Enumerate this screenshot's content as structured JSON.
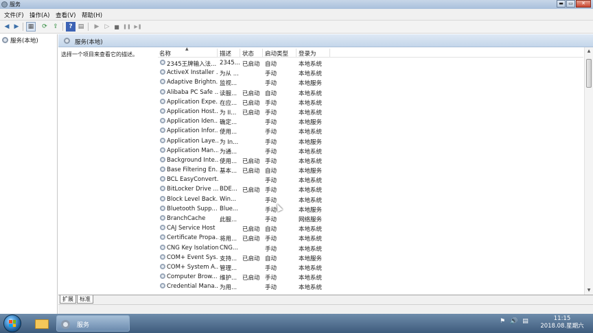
{
  "window": {
    "title": "服务",
    "buttons": {
      "minimize": "▬",
      "maximize": "▭",
      "close": "✕"
    }
  },
  "menu": [
    {
      "label": "文件(F)"
    },
    {
      "label": "操作(A)"
    },
    {
      "label": "查看(V)"
    },
    {
      "label": "帮助(H)"
    }
  ],
  "toolbar": {
    "back_icon": "◀",
    "forward_icon": "▶",
    "view_icon": "▦",
    "refresh_icon": "⟳",
    "export_icon": "⇪",
    "help_icon": "?",
    "properties_icon": "▤",
    "start_icon": "▶",
    "start2_icon": "▷",
    "stop_icon": "■",
    "pause_icon": "❚❚",
    "restart_icon": "▶❚"
  },
  "nav": {
    "root_label": "服务(本地)"
  },
  "main": {
    "header_title": "服务(本地)",
    "description_prompt": "选择一个项目来查看它的描述。",
    "columns": {
      "name": "名称",
      "description": "描述",
      "status": "状态",
      "startup": "启动类型",
      "logon": "登录为"
    },
    "sort_indicator": "▲"
  },
  "services": [
    {
      "name": "2345王牌输入法...",
      "description": "2345...",
      "status": "已启动",
      "startup": "自动",
      "logon": "本地系统"
    },
    {
      "name": "ActiveX Installer ...",
      "description": "为从 ...",
      "status": "",
      "startup": "手动",
      "logon": "本地系统"
    },
    {
      "name": "Adaptive Brightn...",
      "description": "监视...",
      "status": "",
      "startup": "手动",
      "logon": "本地服务"
    },
    {
      "name": "Alibaba PC Safe ...",
      "description": "读服...",
      "status": "已启动",
      "startup": "自动",
      "logon": "本地系统"
    },
    {
      "name": "Application Expe...",
      "description": "在应...",
      "status": "已启动",
      "startup": "手动",
      "logon": "本地系统"
    },
    {
      "name": "Application Host...",
      "description": "为 II...",
      "status": "已启动",
      "startup": "手动",
      "logon": "本地系统"
    },
    {
      "name": "Application Iden...",
      "description": "确定...",
      "status": "",
      "startup": "手动",
      "logon": "本地服务"
    },
    {
      "name": "Application Infor...",
      "description": "使用...",
      "status": "",
      "startup": "手动",
      "logon": "本地系统"
    },
    {
      "name": "Application Laye...",
      "description": "为 In...",
      "status": "",
      "startup": "手动",
      "logon": "本地服务"
    },
    {
      "name": "Application Man...",
      "description": "为通...",
      "status": "",
      "startup": "手动",
      "logon": "本地系统"
    },
    {
      "name": "Background Inte...",
      "description": "使用...",
      "status": "已启动",
      "startup": "手动",
      "logon": "本地系统"
    },
    {
      "name": "Base Filtering En...",
      "description": "基本...",
      "status": "已启动",
      "startup": "自动",
      "logon": "本地服务"
    },
    {
      "name": "BCL EasyConvert...",
      "description": "",
      "status": "",
      "startup": "手动",
      "logon": "本地系统"
    },
    {
      "name": "BitLocker Drive ...",
      "description": "BDE...",
      "status": "已启动",
      "startup": "手动",
      "logon": "本地系统"
    },
    {
      "name": "Block Level Back...",
      "description": "Win...",
      "status": "",
      "startup": "手动",
      "logon": "本地系统"
    },
    {
      "name": "Bluetooth Supp...",
      "description": "Blue...",
      "status": "",
      "startup": "手动",
      "logon": "本地服务"
    },
    {
      "name": "BranchCache",
      "description": "此服...",
      "status": "",
      "startup": "手动",
      "logon": "网络服务"
    },
    {
      "name": "CAJ Service Host",
      "description": "",
      "status": "已启动",
      "startup": "自动",
      "logon": "本地系统"
    },
    {
      "name": "Certificate Propa...",
      "description": "将用...",
      "status": "已启动",
      "startup": "手动",
      "logon": "本地系统"
    },
    {
      "name": "CNG Key Isolation",
      "description": "CNG...",
      "status": "",
      "startup": "手动",
      "logon": "本地系统"
    },
    {
      "name": "COM+ Event Sys...",
      "description": "支持...",
      "status": "已启动",
      "startup": "自动",
      "logon": "本地服务"
    },
    {
      "name": "COM+ System A...",
      "description": "管理...",
      "status": "",
      "startup": "手动",
      "logon": "本地系统"
    },
    {
      "name": "Computer Brow...",
      "description": "维护...",
      "status": "已启动",
      "startup": "手动",
      "logon": "本地系统"
    },
    {
      "name": "Credential Mana...",
      "description": "为用...",
      "status": "",
      "startup": "手动",
      "logon": "本地系统"
    }
  ],
  "tabs": [
    {
      "label": "扩展"
    },
    {
      "label": "标准"
    }
  ],
  "taskbar": {
    "task_label": "服务",
    "tray_icons": {
      "flag": "⚑",
      "volume": "🔊",
      "network": "▤"
    },
    "clock_time": "11:15",
    "clock_date": "2018.08.星期六"
  }
}
